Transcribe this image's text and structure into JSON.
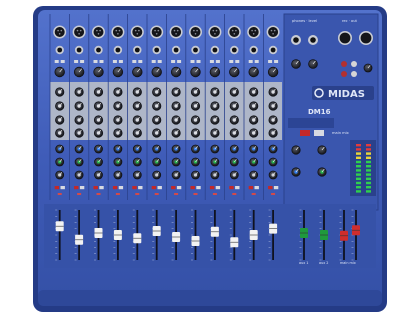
{
  "brand": {
    "logo_text": "MIDAS",
    "model": "DM16"
  },
  "sections": {
    "phones": "phones · level",
    "rec": "rec · out",
    "main_mix": "main mix"
  },
  "fader_labels": {
    "aux1": "aux 1",
    "aux2": "aux 2",
    "main_mix": "main mix"
  },
  "colors": {
    "body": "#3d5ab4",
    "body_dark": "#2c4595",
    "panel_edge": "#203575",
    "grey_strip": "#aeb6c8",
    "knob_dark": "#23252c",
    "cap_blue": "#2f7cf0",
    "cap_green": "#23b24a",
    "cap_red": "#d83434",
    "button_red": "#c42828",
    "meter_green": "#2fd04c",
    "meter_yellow": "#e8d43a",
    "meter_red": "#e23b3b",
    "fader_white": "#f2f2f2",
    "fader_green": "#1f9a3c",
    "fader_red": "#cf2d2d"
  },
  "controls": {
    "input_channels": 12,
    "fader_levels": [
      0.72,
      0.38,
      0.55,
      0.5,
      0.42,
      0.6,
      0.45,
      0.35,
      0.58,
      0.32,
      0.5,
      0.66
    ],
    "aux_fader_levels": [
      0.55,
      0.5
    ],
    "main_fader_levels": [
      0.48,
      0.62
    ]
  }
}
